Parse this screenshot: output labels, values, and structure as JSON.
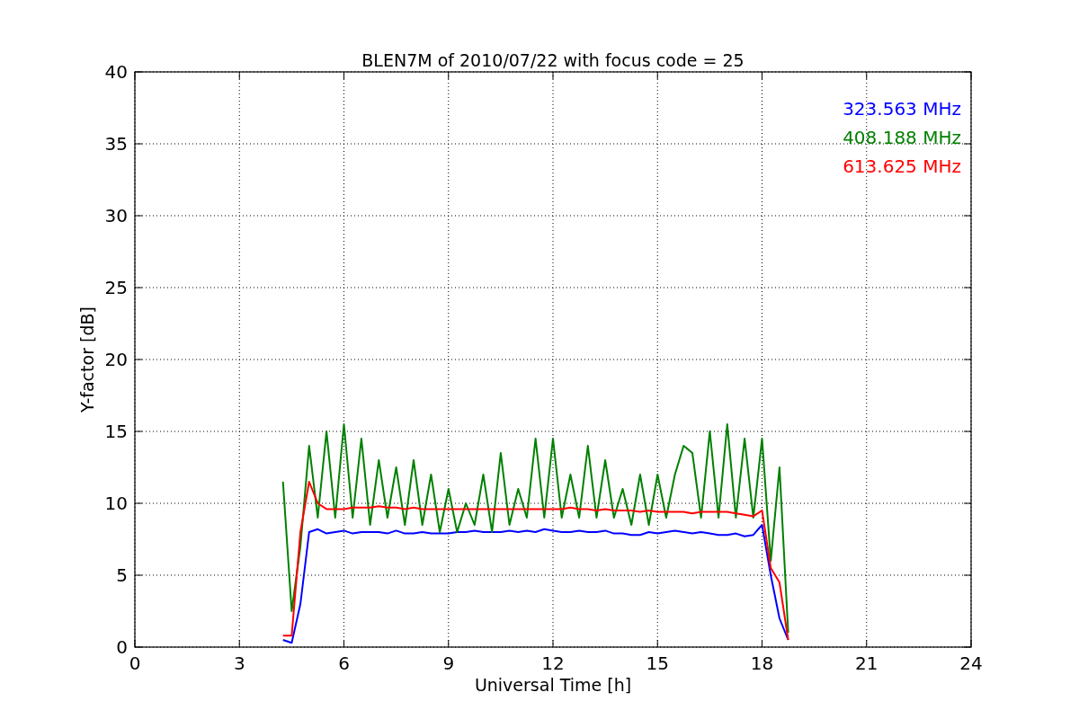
{
  "chart_data": {
    "type": "line",
    "title": "BLEN7M of 2010/07/22 with focus code = 25",
    "xlabel": "Universal Time [h]",
    "ylabel": "Y-factor [dB]",
    "x": [
      4.25,
      4.5,
      4.75,
      5,
      5.25,
      5.5,
      5.75,
      6,
      6.25,
      6.5,
      6.75,
      7,
      7.25,
      7.5,
      7.75,
      8,
      8.25,
      8.5,
      8.75,
      9,
      9.25,
      9.5,
      9.75,
      10,
      10.25,
      10.5,
      10.75,
      11,
      11.25,
      11.5,
      11.75,
      12,
      12.25,
      12.5,
      12.75,
      13,
      13.25,
      13.5,
      13.75,
      14,
      14.25,
      14.5,
      14.75,
      15,
      15.25,
      15.5,
      15.75,
      16,
      16.25,
      16.5,
      16.75,
      17,
      17.25,
      17.5,
      17.75,
      18,
      18.25,
      18.5,
      18.75
    ],
    "series": [
      {
        "name": "323.563 MHz",
        "color": "#0000ff",
        "values": [
          0.5,
          0.3,
          3,
          8,
          8.2,
          7.9,
          8,
          8.1,
          7.9,
          8,
          8,
          8,
          7.9,
          8.1,
          7.9,
          7.9,
          8,
          7.9,
          7.9,
          7.9,
          8,
          8,
          8.1,
          8,
          8,
          8,
          8.1,
          8,
          8.1,
          8,
          8.2,
          8.1,
          8,
          8,
          8.1,
          8,
          8,
          8.1,
          7.9,
          7.9,
          7.8,
          7.8,
          8,
          7.9,
          8,
          8.1,
          8,
          7.9,
          8,
          7.9,
          7.8,
          7.8,
          7.9,
          7.7,
          7.8,
          8.5,
          5,
          2,
          0.5
        ]
      },
      {
        "name": "408.188 MHz",
        "color": "#008000",
        "values": [
          11.5,
          2.5,
          7,
          14,
          9,
          15,
          9,
          15.5,
          9,
          14.5,
          8.5,
          13,
          9,
          12.5,
          8.5,
          13,
          8.5,
          12,
          8,
          11,
          8,
          10,
          8.5,
          12,
          8,
          13.5,
          8.5,
          11,
          9,
          14.5,
          9,
          14.5,
          9,
          12,
          9,
          14,
          9,
          13,
          9,
          11,
          8.5,
          12,
          8.5,
          12,
          9,
          12,
          14,
          13.5,
          9,
          15,
          9,
          15.5,
          9,
          14.5,
          9,
          14.5,
          6,
          12.5,
          1
        ]
      },
      {
        "name": "613.625 MHz",
        "color": "#ff0000",
        "values": [
          0.8,
          0.8,
          8,
          11.5,
          10,
          9.6,
          9.6,
          9.6,
          9.7,
          9.7,
          9.7,
          9.8,
          9.7,
          9.7,
          9.6,
          9.7,
          9.6,
          9.6,
          9.6,
          9.6,
          9.6,
          9.6,
          9.6,
          9.6,
          9.6,
          9.6,
          9.6,
          9.6,
          9.6,
          9.6,
          9.6,
          9.6,
          9.6,
          9.7,
          9.6,
          9.6,
          9.5,
          9.6,
          9.5,
          9.5,
          9.5,
          9.4,
          9.5,
          9.4,
          9.4,
          9.4,
          9.4,
          9.3,
          9.4,
          9.4,
          9.4,
          9.4,
          9.3,
          9.2,
          9.1,
          9.5,
          5.5,
          4.5,
          0.5
        ]
      }
    ],
    "xlim": [
      0,
      24
    ],
    "ylim": [
      0,
      40
    ],
    "xticks": [
      0,
      3,
      6,
      9,
      12,
      15,
      18,
      21,
      24
    ],
    "yticks": [
      0,
      5,
      10,
      15,
      20,
      25,
      30,
      35,
      40
    ],
    "grid": true
  }
}
